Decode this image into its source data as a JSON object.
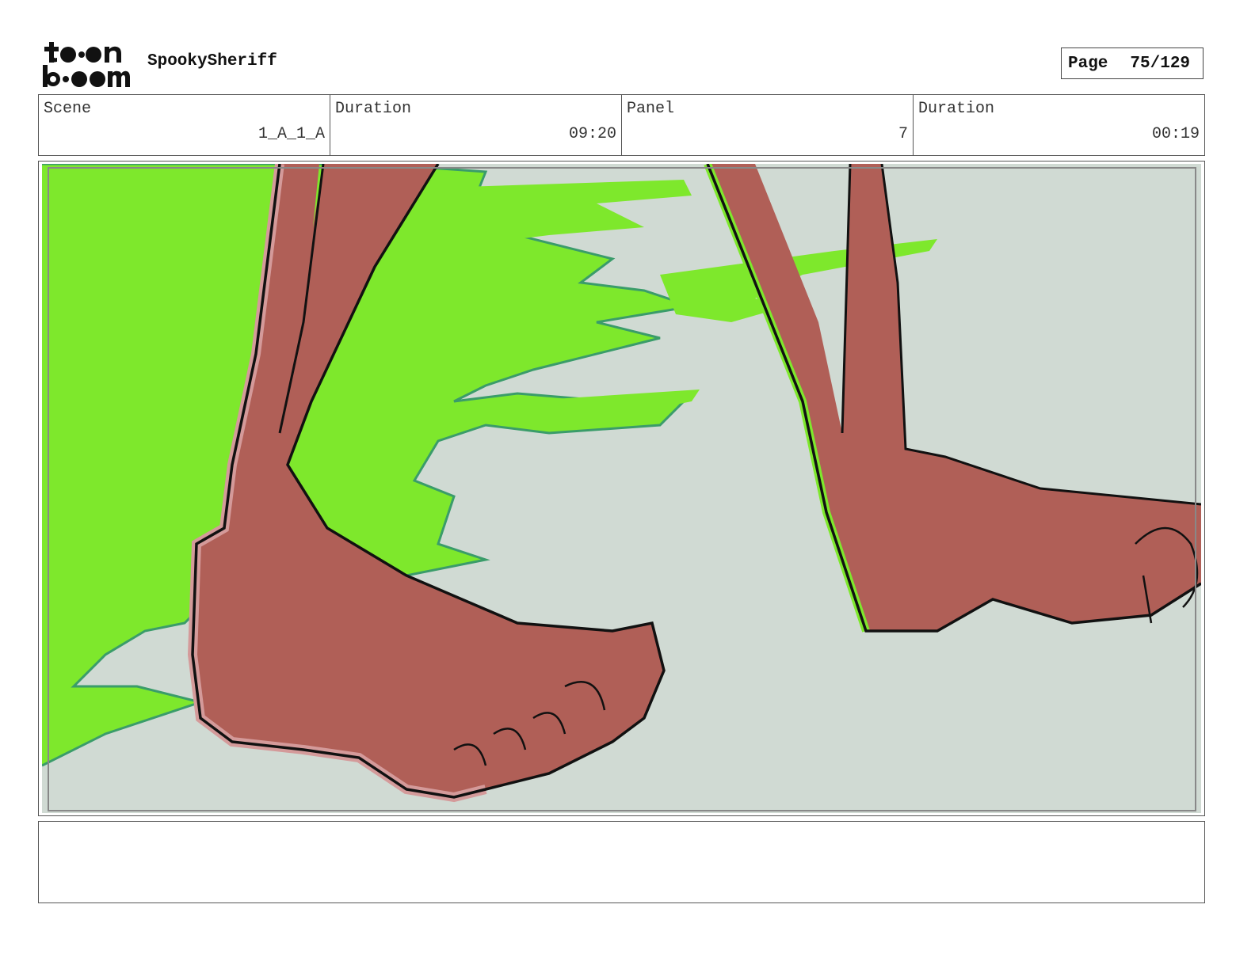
{
  "header": {
    "logo_text": "toon boom",
    "project_name": "SpookySheriff",
    "page_label": "Page",
    "page_number": "75/129"
  },
  "info": {
    "scene_label": "Scene",
    "scene_value": "1_A_1_A",
    "scene_duration_label": "Duration",
    "scene_duration_value": "09:20",
    "panel_label": "Panel",
    "panel_value": "7",
    "panel_duration_label": "Duration",
    "panel_duration_value": "00:19"
  },
  "colors": {
    "background": "#d0dad3",
    "slime": "#7ee82c",
    "slime_edge": "#3a9c6a",
    "skin": "#b05f57",
    "skin_highlight": "#d49a9a",
    "outline": "#111111"
  },
  "panel": {
    "illustration": "feet-stepping-through-green-slime"
  },
  "notes": {
    "text": ""
  }
}
